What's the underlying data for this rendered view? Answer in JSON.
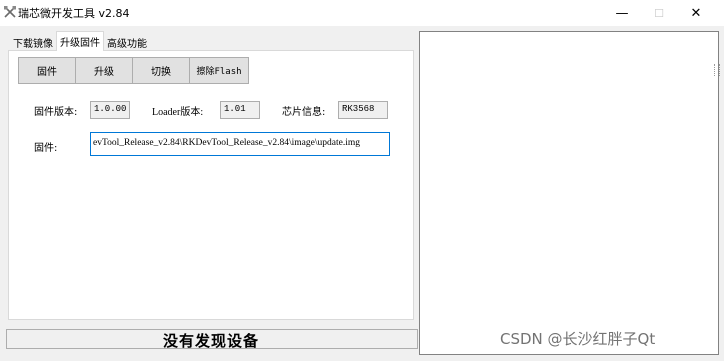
{
  "window": {
    "title": "瑞芯微开发工具 v2.84",
    "icon": "crossed-tools-icon",
    "minimize_glyph": "—",
    "maximize_glyph": "☐",
    "close_glyph": "✕"
  },
  "tabs": [
    {
      "label": "下载镜像",
      "active": false
    },
    {
      "label": "升级固件",
      "active": true
    },
    {
      "label": "高级功能",
      "active": false
    }
  ],
  "buttons": {
    "firmware": "固件",
    "upgrade": "升级",
    "switch": "切换",
    "erase_flash": "擦除Flash"
  },
  "info": {
    "firmware_version_label": "固件版本:",
    "firmware_version": "1.0.00",
    "loader_version_label": "Loader版本:",
    "loader_version": "1.01",
    "chip_info_label": "芯片信息:",
    "chip_info": "RK3568"
  },
  "firmware_path": {
    "label": "固件:",
    "value": "evTool_Release_v2.84\\RKDevTool_Release_v2.84\\image\\update.img"
  },
  "status": {
    "text": "没有发现设备"
  },
  "watermark": "CSDN @长沙红胖子Qt",
  "colors": {
    "accent_border": "#0078d7",
    "button_face": "#e1e1e1",
    "window_bg": "#f0f0f0"
  }
}
